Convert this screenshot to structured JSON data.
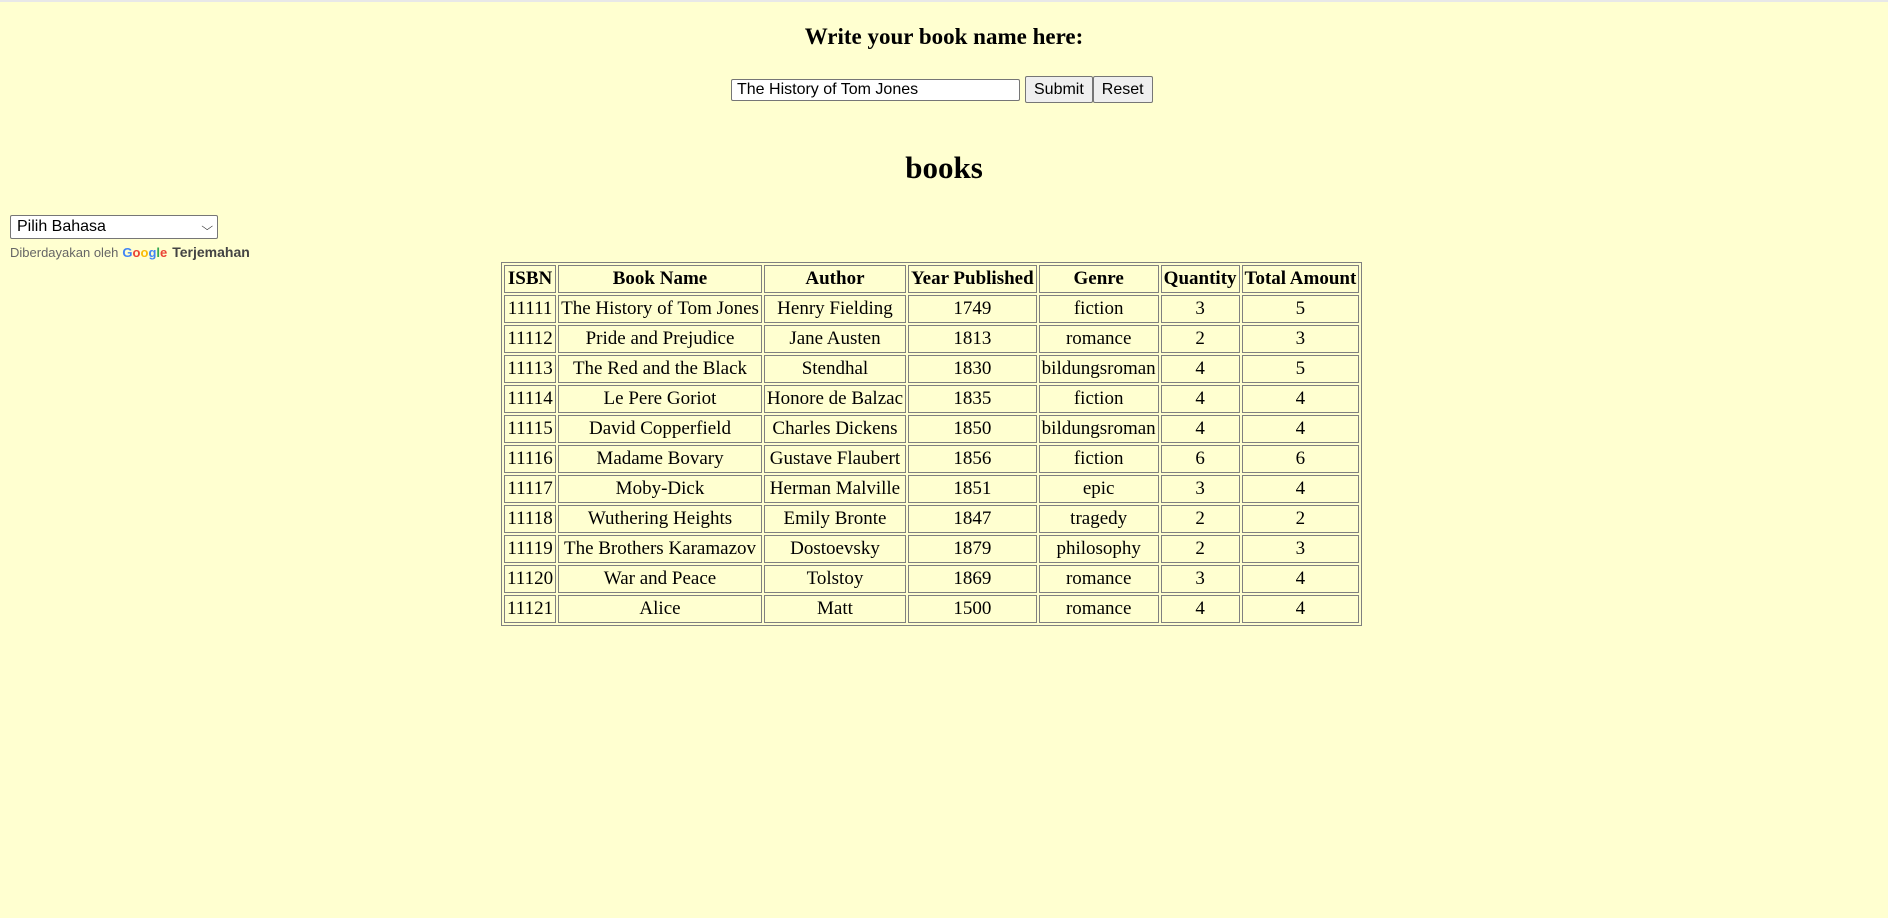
{
  "form": {
    "heading": "Write your book name here:",
    "input_value": "The History of Tom Jones",
    "submit_label": "Submit",
    "reset_label": "Reset"
  },
  "page": {
    "heading": "books"
  },
  "translate": {
    "select_value": "Pilih Bahasa",
    "powered_by": "Diberdayakan oleh",
    "google_logo_text": "Google",
    "link_label": "Terjemahan"
  },
  "table": {
    "headers": [
      "ISBN",
      "Book Name",
      "Author",
      "Year Published",
      "Genre",
      "Quantity",
      "Total Amount"
    ],
    "rows": [
      [
        "11111",
        "The History of Tom Jones",
        "Henry Fielding",
        "1749",
        "fiction",
        "3",
        "5"
      ],
      [
        "11112",
        "Pride and Prejudice",
        "Jane Austen",
        "1813",
        "romance",
        "2",
        "3"
      ],
      [
        "11113",
        "The Red and the Black",
        "Stendhal",
        "1830",
        "bildungsroman",
        "4",
        "5"
      ],
      [
        "11114",
        "Le Pere Goriot",
        "Honore de Balzac",
        "1835",
        "fiction",
        "4",
        "4"
      ],
      [
        "11115",
        "David Copperfield",
        "Charles Dickens",
        "1850",
        "bildungsroman",
        "4",
        "4"
      ],
      [
        "11116",
        "Madame Bovary",
        "Gustave Flaubert",
        "1856",
        "fiction",
        "6",
        "6"
      ],
      [
        "11117",
        "Moby-Dick",
        "Herman Malville",
        "1851",
        "epic",
        "3",
        "4"
      ],
      [
        "11118",
        "Wuthering Heights",
        "Emily Bronte",
        "1847",
        "tragedy",
        "2",
        "2"
      ],
      [
        "11119",
        "The Brothers Karamazov",
        "Dostoevsky",
        "1879",
        "philosophy",
        "2",
        "3"
      ],
      [
        "11120",
        "War and Peace",
        "Tolstoy",
        "1869",
        "romance",
        "3",
        "4"
      ],
      [
        "11121",
        "Alice",
        "Matt",
        "1500",
        "romance",
        "4",
        "4"
      ]
    ]
  },
  "colors": {
    "page_background": "#ffffd0",
    "border": "#808080"
  }
}
